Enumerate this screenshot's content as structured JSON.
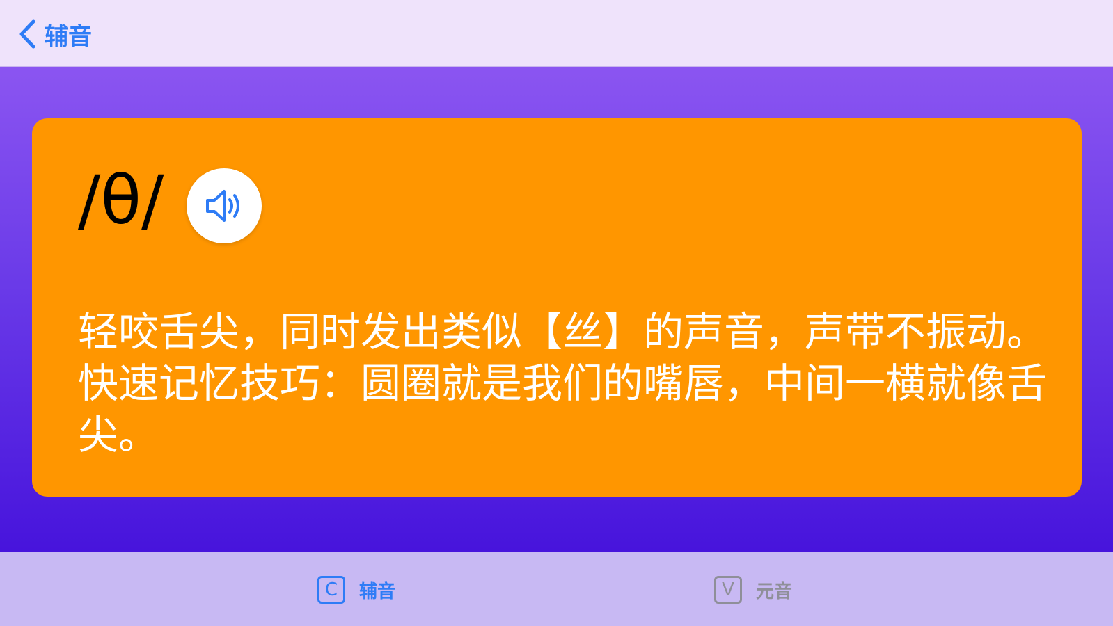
{
  "nav": {
    "back_label": "辅音"
  },
  "card": {
    "phonetic": "/θ/",
    "sound_icon": "speaker-icon",
    "description": "轻咬舌尖，同时发出类似【丝】的声音，声带不振动。快速记忆技巧：圆圈就是我们的嘴唇，中间一横就像舌尖。"
  },
  "tabs": [
    {
      "icon_letter": "C",
      "label": "辅音",
      "selected": true
    },
    {
      "icon_letter": "V",
      "label": "元音",
      "selected": false
    }
  ],
  "colors": {
    "accent": "#2e7cf6",
    "card": "#ff9600",
    "inactive": "#8f8f99"
  }
}
